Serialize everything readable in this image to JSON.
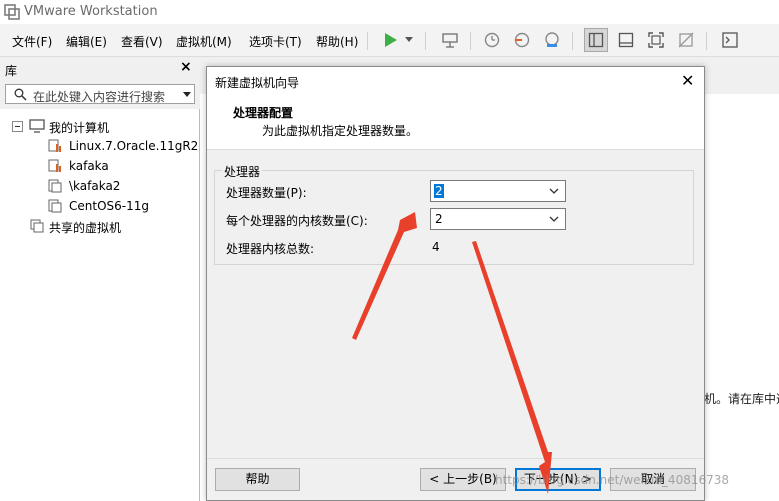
{
  "app": {
    "title": "VMware Workstation"
  },
  "menu": [
    "文件(F)",
    "编辑(E)",
    "查看(V)",
    "虚拟机(M)",
    "选项卡(T)",
    "帮助(H)"
  ],
  "toolbar_icons": [
    "play-icon",
    "dropdown-arrow-icon",
    "send-keys-icon",
    "snapshot-icon",
    "revert-snapshot-icon",
    "manage-snapshots-icon",
    "library-view-icon",
    "console-view-icon",
    "fullscreen-icon",
    "unity-icon",
    "terminal-icon"
  ],
  "library": {
    "title": "库",
    "close": "×",
    "search_placeholder": "在此处键入内容进行搜索",
    "tree": {
      "root": "我的计算机",
      "vms": [
        "Linux.7.Oracle.11gR2",
        "kafaka",
        "\\kafaka2",
        "CentOS6-11g"
      ],
      "shared": "共享的虚拟机"
    }
  },
  "main": {
    "hint": "机。请在库中选"
  },
  "dialog": {
    "title": "新建虚拟机向导",
    "close": "✕",
    "heading": "处理器配置",
    "subheading": "为此虚拟机指定处理器数量。",
    "group": "处理器",
    "processors_label": "处理器数量(P):",
    "processors_value": "2",
    "cores_label": "每个处理器的内核数量(C):",
    "cores_value": "2",
    "total_label": "处理器内核总数:",
    "total_value": "4",
    "buttons": {
      "help": "帮助",
      "back": "< 上一步(B)",
      "next": "下一步(N) >",
      "cancel": "取消"
    }
  },
  "watermark": "https://blog.csdn.net/weixin_40816738",
  "colors": {
    "accent": "#0078d7",
    "arrow": "#e8402a",
    "play": "#3cb043"
  }
}
